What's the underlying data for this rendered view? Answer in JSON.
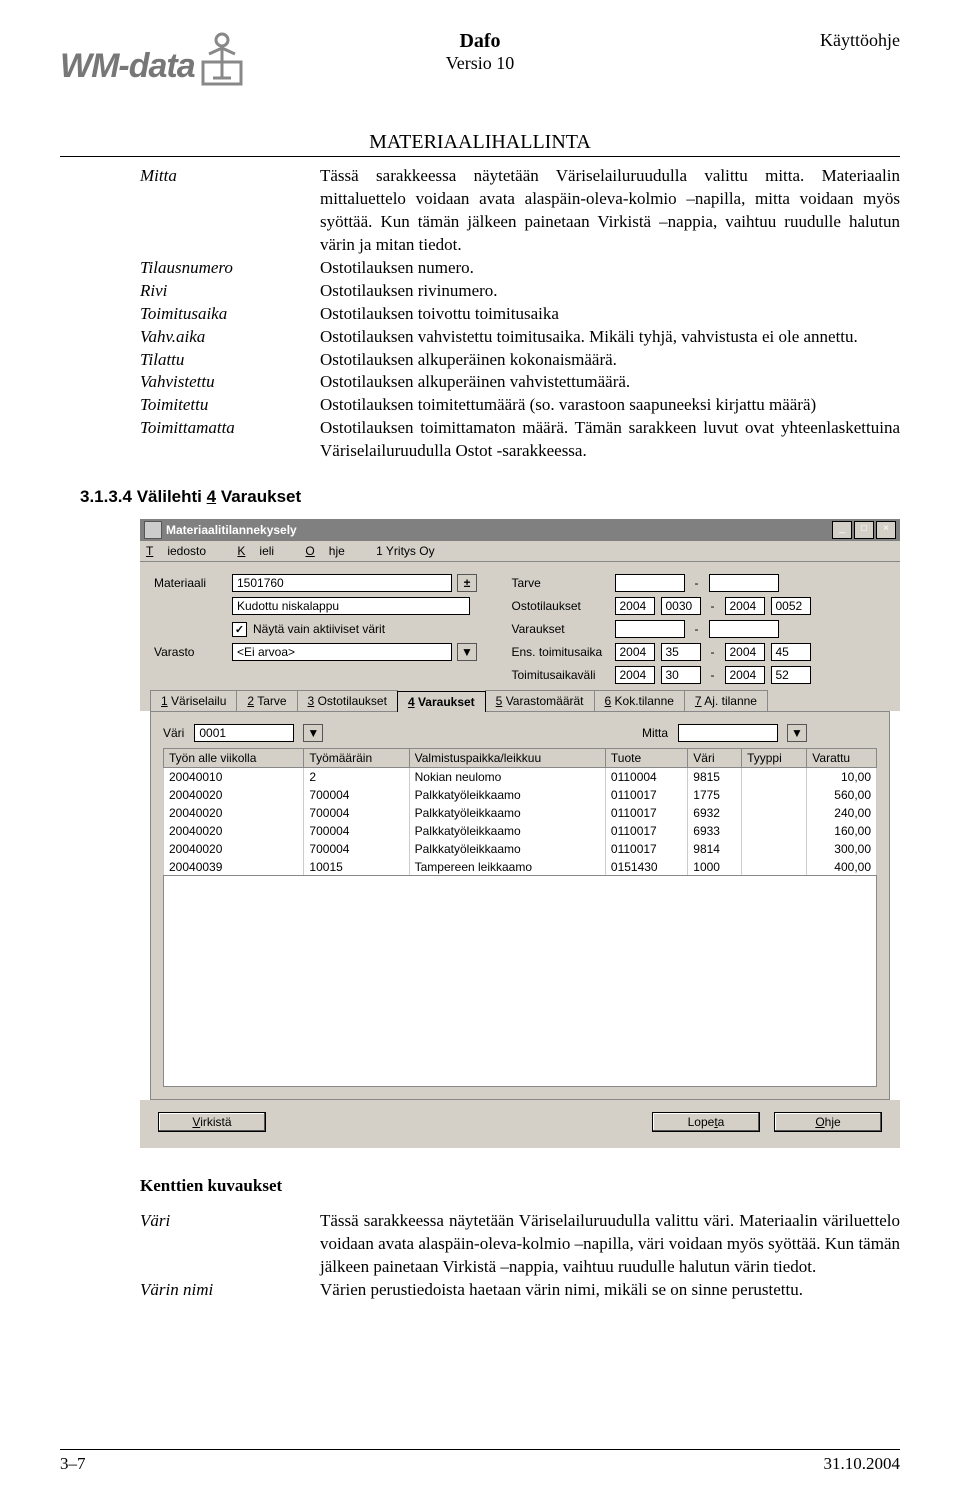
{
  "header": {
    "logo_text": "WM-data",
    "title_line1": "Dafo",
    "title_line2": "Versio 10",
    "right_text": "Käyttöohje",
    "section_title": "MATERIAALIHALLINTA"
  },
  "definitions": [
    {
      "term": "Mitta",
      "desc": "Tässä sarakkeessa näytetään Väriselailuruudulla valittu mitta. Materiaalin mittaluettelo voidaan avata alaspäin-oleva-kolmio –napilla, mitta voidaan myös syöttää. Kun tämän jälkeen painetaan Virkistä –nappia, vaihtuu ruudulle halutun värin ja mitan tiedot."
    },
    {
      "term": "Tilausnumero",
      "desc": "Ostotilauksen numero."
    },
    {
      "term": "Rivi",
      "desc": "Ostotilauksen rivinumero."
    },
    {
      "term": "Toimitusaika",
      "desc": "Ostotilauksen toivottu toimitusaika"
    },
    {
      "term": "Vahv.aika",
      "desc": "Ostotilauksen vahvistettu toimitusaika. Mikäli tyhjä, vahvistusta ei ole annettu."
    },
    {
      "term": "Tilattu",
      "desc": "Ostotilauksen alkuperäinen kokonaismäärä."
    },
    {
      "term": "Vahvistettu",
      "desc": "Ostotilauksen alkuperäinen vahvistettumäärä."
    },
    {
      "term": "Toimitettu",
      "desc": "Ostotilauksen toimitettumäärä (so. varastoon saapuneeksi kirjattu määrä)"
    },
    {
      "term": "Toimittamatta",
      "desc": "Ostotilauksen toimittamaton määrä. Tämän sarakkeen luvut ovat yhteenlaskettuina Väriselailuruudulla Ostot -sarakkeessa."
    }
  ],
  "heading": {
    "prefix": "3.1.3.4 Välilehti ",
    "underline": "4",
    "suffix": " Varaukset"
  },
  "app": {
    "title": "Materiaalitilannekysely",
    "menu": {
      "tiedosto": "Tiedosto",
      "kieli": "Kieli",
      "ohje": "Ohje",
      "yritys": "1 Yritys Oy"
    },
    "form": {
      "materiaali_label": "Materiaali",
      "materiaali_value": "1501760",
      "materiaali_desc": "Kudottu niskalappu",
      "check_label": "Näytä vain aktiiviset värit",
      "check_value": "✓",
      "varasto_label": "Varasto",
      "varasto_value": "<Ei arvoa>",
      "tarve_label": "Tarve",
      "tarve_v1": "",
      "tarve_v2": "",
      "ostot_label": "Ostotilaukset",
      "ostot_y1": "2004",
      "ostot_w1": "0030",
      "ostot_y2": "2004",
      "ostot_w2": "0052",
      "varaukset_label": "Varaukset",
      "var_v1": "",
      "var_v2": "",
      "ens_label": "Ens. toimitusaika",
      "ens_y1": "2004",
      "ens_w1": "35",
      "ens_y2": "2004",
      "ens_w2": "45",
      "vali_label": "Toimitusaikaväli",
      "vali_y1": "2004",
      "vali_w1": "30",
      "vali_y2": "2004",
      "vali_w2": "52"
    },
    "tabs": [
      {
        "u": "1",
        "label": " Väriselailu"
      },
      {
        "u": "2",
        "label": " Tarve"
      },
      {
        "u": "3",
        "label": " Ostotilaukset"
      },
      {
        "u": "4",
        "label": " Varaukset",
        "active": true
      },
      {
        "u": "5",
        "label": " Varastomäärät"
      },
      {
        "u": "6",
        "label": " Kok.tilanne"
      },
      {
        "u": "7",
        "label": " Aj. tilanne"
      }
    ],
    "filter": {
      "vari_label": "Väri",
      "vari_value": "0001",
      "mitta_label": "Mitta",
      "mitta_value": ""
    },
    "table": {
      "headers": [
        "Työn alle viikolla",
        "Työmääräin",
        "Valmistuspaikka/leikkuu",
        "Tuote",
        "Väri",
        "Tyyppi",
        "Varattu"
      ],
      "rows": [
        [
          "20040010",
          "2",
          "Nokian neulomo",
          "0110004",
          "9815",
          "",
          "10,00"
        ],
        [
          "20040020",
          "700004",
          "Palkkatyöleikkaamo",
          "0110017",
          "1775",
          "",
          "560,00"
        ],
        [
          "20040020",
          "700004",
          "Palkkatyöleikkaamo",
          "0110017",
          "6932",
          "",
          "240,00"
        ],
        [
          "20040020",
          "700004",
          "Palkkatyöleikkaamo",
          "0110017",
          "6933",
          "",
          "160,00"
        ],
        [
          "20040020",
          "700004",
          "Palkkatyöleikkaamo",
          "0110017",
          "9814",
          "",
          "300,00"
        ],
        [
          "20040039",
          "10015",
          "Tampereen leikkaamo",
          "0151430",
          "1000",
          "",
          "400,00"
        ]
      ]
    },
    "buttons": {
      "virkista": "Virkistä",
      "lopeta": "Lopeta",
      "ohje": "Ohje"
    }
  },
  "subheading": "Kenttien kuvaukset",
  "definitions2": [
    {
      "term": "Väri",
      "desc": "Tässä sarakkeessa näytetään Väriselailuruudulla valittu väri. Materiaalin väriluettelo voidaan avata alaspäin-oleva-kolmio –napilla, väri voidaan myös syöttää. Kun tämän jälkeen painetaan Virkistä –nappia, vaihtuu ruudulle halutun värin tiedot."
    },
    {
      "term": "Värin nimi",
      "desc": "Värien perustiedoista haetaan värin nimi, mikäli se on sinne perustettu."
    }
  ],
  "footer": {
    "left": "3–7",
    "right": "31.10.2004"
  }
}
